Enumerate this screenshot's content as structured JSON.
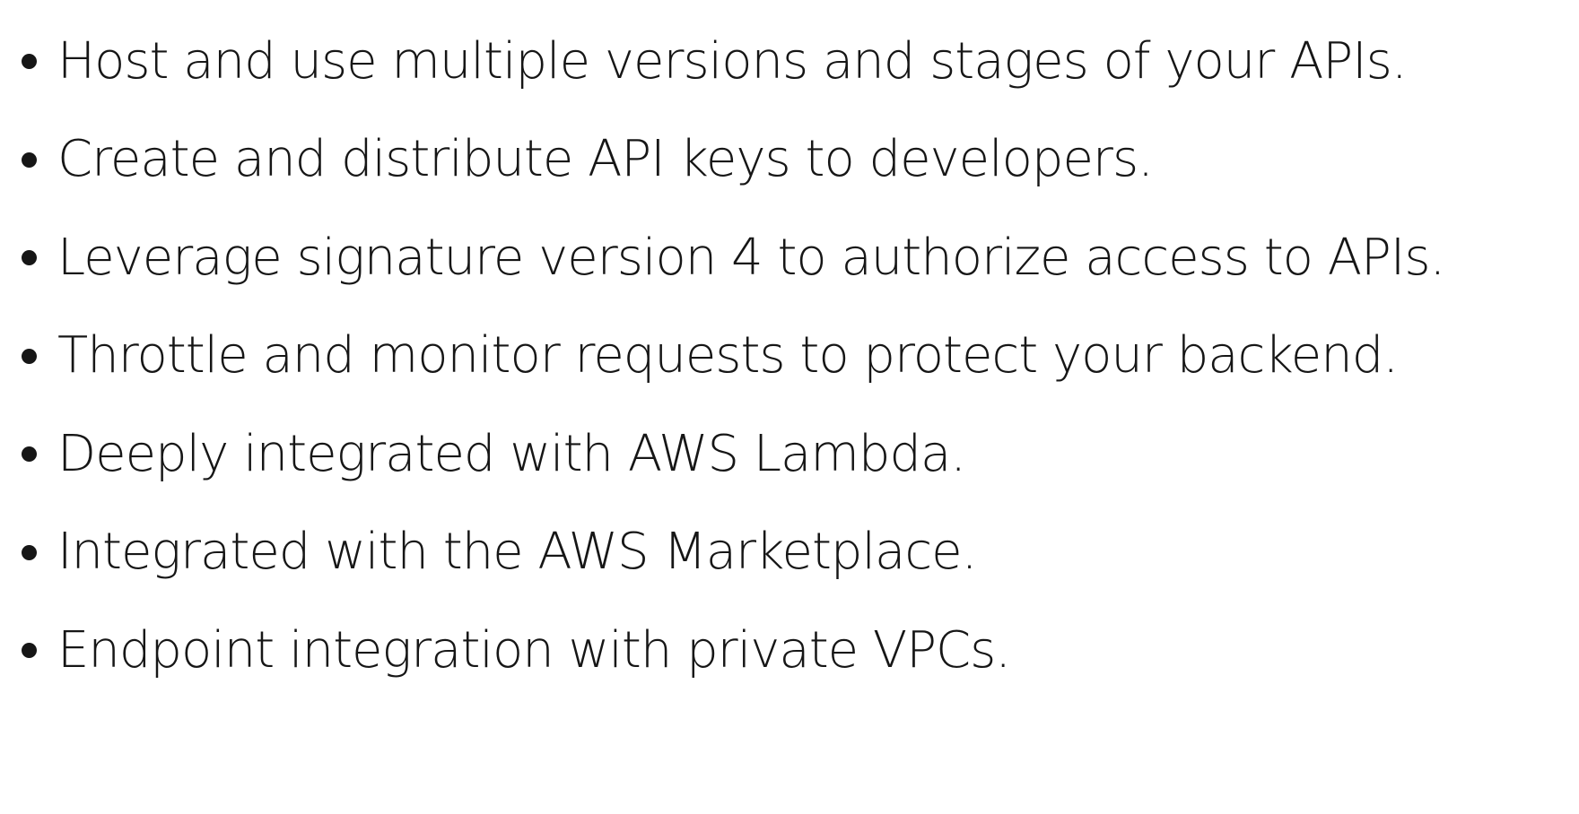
{
  "bullets": [
    "Host and use multiple versions and stages of your APIs.",
    "Create and distribute API keys to developers.",
    "Leverage signature version 4 to authorize access to APIs.",
    "Throttle and monitor requests to protect your backend.",
    "Deeply integrated with AWS Lambda.",
    "Integrated with the AWS Marketplace.",
    "Endpoint integration with private VPCs."
  ]
}
